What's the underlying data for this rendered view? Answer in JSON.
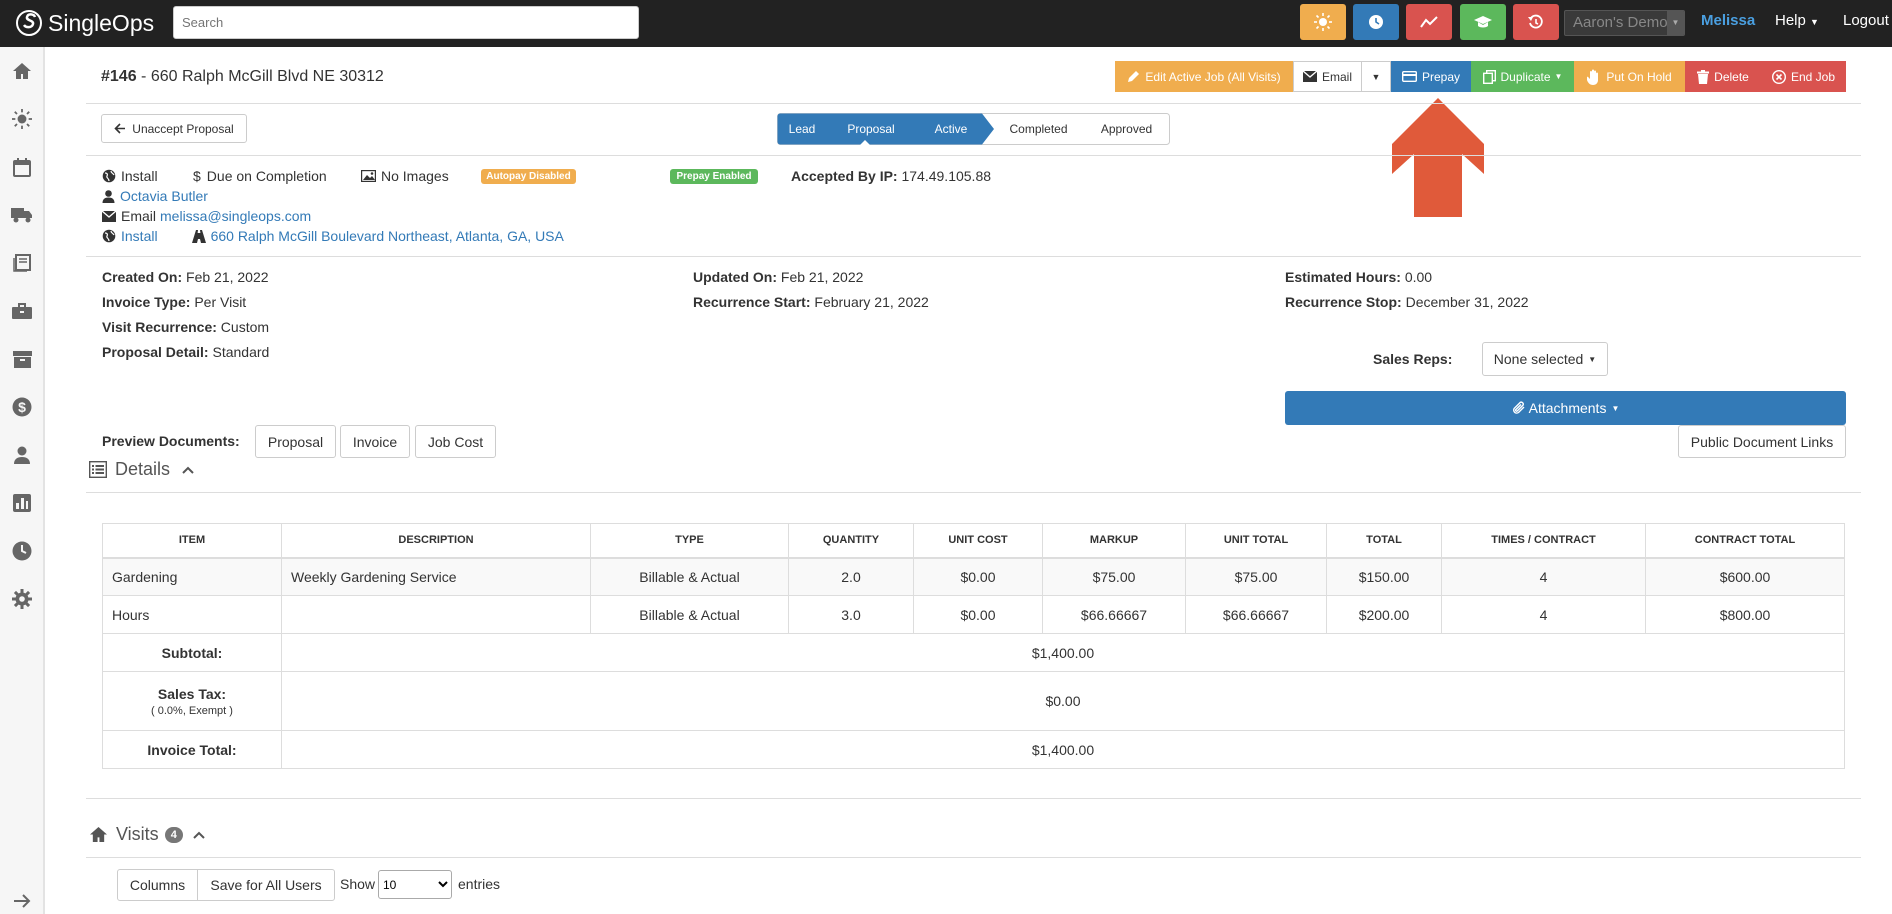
{
  "app": {
    "brand": "SingleOps",
    "search_placeholder": "Search",
    "account_select": "Aaron's Demo",
    "user": "Melissa",
    "help": "Help",
    "logout": "Logout"
  },
  "quick_buttons": [
    {
      "icon": "sun-icon",
      "color": "#f0ad4e"
    },
    {
      "icon": "clock-icon",
      "color": "#337ab7"
    },
    {
      "icon": "trend-line-icon",
      "color": "#d9534f"
    },
    {
      "icon": "graduation-cap-icon",
      "color": "#5cb85c"
    },
    {
      "icon": "history-icon",
      "color": "#d9534f"
    }
  ],
  "sidebar_icons": [
    "home-icon",
    "sun-icon",
    "calendar-icon",
    "truck-icon",
    "book-icon",
    "briefcase-icon",
    "archive-icon",
    "dollar-icon",
    "person-icon",
    "bar-chart-icon",
    "clock-icon",
    "gear-icon",
    "arrow-right-icon"
  ],
  "job": {
    "number": "#146",
    "address": " - 660 Ralph McGill Blvd NE 30312"
  },
  "actions": {
    "edit_active_job": "Edit Active Job (All Visits)",
    "email": "Email",
    "prepay": "Prepay",
    "duplicate": "Duplicate",
    "put_on_hold": "Put On Hold",
    "delete": "Delete",
    "end_job": "End Job"
  },
  "unaccept_proposal": "Unaccept Proposal",
  "steps": [
    "Lead",
    "Proposal",
    "Active",
    "Completed",
    "Approved"
  ],
  "info": {
    "type": "Install",
    "payment_terms": "Due on Completion",
    "images": "No Images",
    "autopay_badge": "Autopay Disabled",
    "prepay_badge": "Prepay Enabled",
    "accepted_by_ip_label": "Accepted By IP:",
    "accepted_by_ip": "174.49.105.88",
    "contact_name": "Octavia Butler",
    "email_label": "Email",
    "email": "melissa@singleops.com",
    "location_type": "Install",
    "full_address": "660 Ralph McGill Boulevard Northeast, Atlanta, GA, USA"
  },
  "meta": {
    "created_on_label": "Created On:",
    "created_on": "Feb 21, 2022",
    "invoice_type_label": "Invoice Type:",
    "invoice_type": "Per Visit",
    "visit_recurrence_label": "Visit Recurrence:",
    "visit_recurrence": "Custom",
    "proposal_detail_label": "Proposal Detail:",
    "proposal_detail": "Standard",
    "updated_on_label": "Updated On:",
    "updated_on": "Feb 21, 2022",
    "recurrence_start_label": "Recurrence Start:",
    "recurrence_start": "February 21, 2022",
    "estimated_hours_label": "Estimated Hours:",
    "estimated_hours": "0.00",
    "recurrence_stop_label": "Recurrence Stop:",
    "recurrence_stop": "December 31, 2022",
    "sales_reps_label": "Sales Reps:",
    "sales_reps_value": "None selected",
    "attachments": "Attachments"
  },
  "preview": {
    "label": "Preview Documents:",
    "proposal": "Proposal",
    "invoice": "Invoice",
    "job_cost": "Job Cost",
    "public_links": "Public Document Links"
  },
  "details": {
    "title": "Details",
    "columns": [
      "ITEM",
      "DESCRIPTION",
      "TYPE",
      "QUANTITY",
      "UNIT COST",
      "MARKUP",
      "UNIT TOTAL",
      "TOTAL",
      "TIMES / CONTRACT",
      "CONTRACT TOTAL"
    ],
    "rows": [
      [
        "Gardening",
        "Weekly Gardening Service",
        "Billable & Actual",
        "2.0",
        "$0.00",
        "$75.00",
        "$75.00",
        "$150.00",
        "4",
        "$600.00"
      ],
      [
        "Hours",
        "",
        "Billable & Actual",
        "3.0",
        "$0.00",
        "$66.66667",
        "$66.66667",
        "$200.00",
        "4",
        "$800.00"
      ]
    ],
    "subtotal_label": "Subtotal:",
    "subtotal": "$1,400.00",
    "sales_tax_label": "Sales Tax:",
    "sales_tax_note": "( 0.0%, Exempt )",
    "sales_tax": "$0.00",
    "invoice_total_label": "Invoice Total:",
    "invoice_total": "$1,400.00"
  },
  "visits": {
    "title": "Visits",
    "count": "4",
    "columns_btn": "Columns",
    "save_btn": "Save for All Users",
    "show_label": "Show",
    "entries_value": "10",
    "entries_label": "entries"
  }
}
